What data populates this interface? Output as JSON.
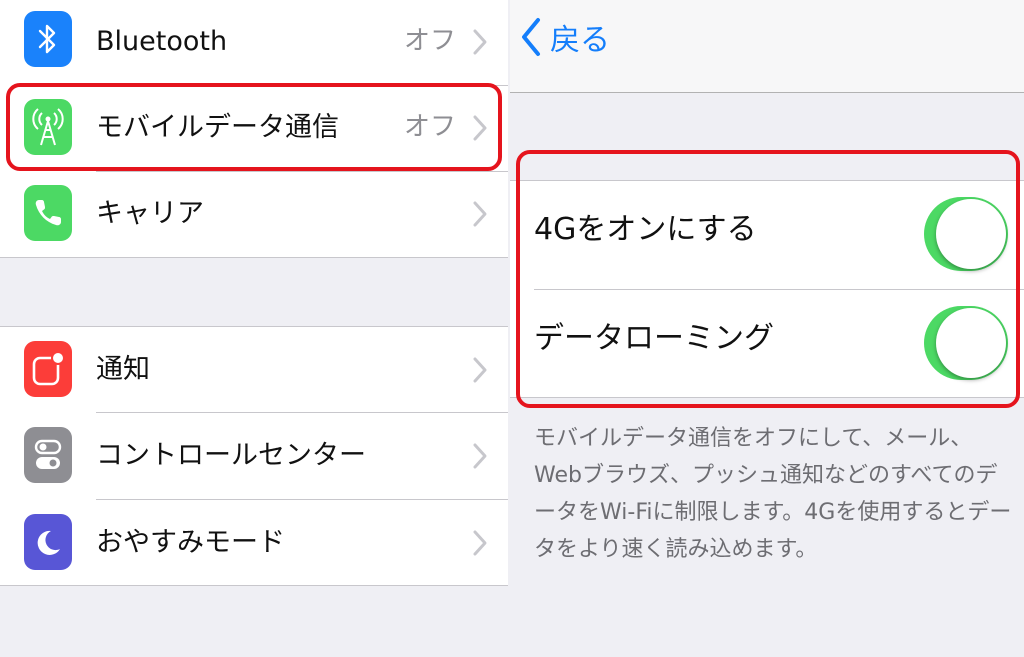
{
  "left": {
    "group1": [
      {
        "label": "Bluetooth",
        "value": "オフ",
        "icon": "bluetooth-icon",
        "icon_color": "#1a82fb"
      },
      {
        "label": "モバイルデータ通信",
        "value": "オフ",
        "icon": "antenna-icon",
        "icon_color": "#4cd964"
      },
      {
        "label": "キャリア",
        "value": "",
        "icon": "phone-icon",
        "icon_color": "#4cd964"
      }
    ],
    "group2": [
      {
        "label": "通知",
        "icon": "notifications-icon",
        "icon_color": "#fc3d39"
      },
      {
        "label": "コントロールセンター",
        "icon": "control-center-icon",
        "icon_color": "#8e8e93"
      },
      {
        "label": "おやすみモード",
        "icon": "moon-icon",
        "icon_color": "#5856d6"
      }
    ]
  },
  "right": {
    "back_label": "戻る",
    "toggles": [
      {
        "label": "4Gをオンにする",
        "on": true
      },
      {
        "label": "データローミング",
        "on": true
      }
    ],
    "footnote": "モバイルデータ通信をオフにして、メール、Webブラウズ、プッシュ通知などのすべてのデータをWi-Fiに制限します。4Gを使用するとデータをより速く読み込めます。"
  },
  "colors": {
    "accent": "#147efb",
    "toggle_on": "#4cd964",
    "highlight": "#e5141d"
  }
}
